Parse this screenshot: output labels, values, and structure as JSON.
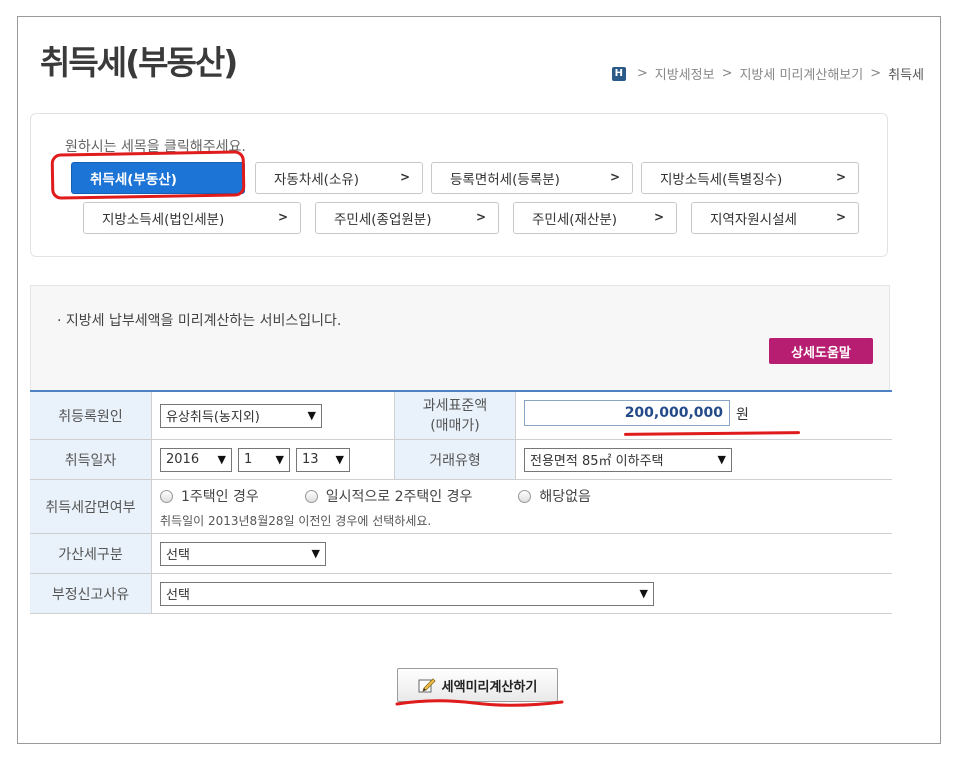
{
  "page": {
    "title": "취득세(부동산)"
  },
  "breadcrumb": {
    "home_icon": "H",
    "sep": ">",
    "items": [
      "지방세정보",
      "지방세 미리계산해보기",
      "취득세"
    ]
  },
  "tax_select": {
    "prompt": "원하시는 세목을 클릭해주세요.",
    "chevron": ">",
    "items": [
      {
        "label": "취득세(부동산)"
      },
      {
        "label": "자동차세(소유)"
      },
      {
        "label": "등록면허세(등록분)"
      },
      {
        "label": "지방소득세(특별징수)"
      },
      {
        "label": "지방소득세(법인세분)"
      },
      {
        "label": "주민세(종업원분)"
      },
      {
        "label": "주민세(재산분)"
      },
      {
        "label": "지역자원시설세"
      }
    ]
  },
  "info": {
    "text": "· 지방세 납부세액을 미리계산하는 서비스입니다.",
    "help_button": "상세도움말"
  },
  "form": {
    "acquisition_cause": {
      "label": "취등록원인",
      "value": "유상취득(농지외)"
    },
    "tax_base": {
      "label_line1": "과세표준액",
      "label_line2": "(매매가)",
      "value": "200,000,000",
      "unit": "원"
    },
    "acquisition_date": {
      "label": "취득일자",
      "year": "2016",
      "month": "1",
      "day": "13"
    },
    "transaction_type": {
      "label": "거래유형",
      "value": "전용면적 85㎡ 이하주택"
    },
    "reduction": {
      "label": "취득세감면여부",
      "options": [
        "1주택인 경우",
        "일시적으로 2주택인 경우",
        "해당없음"
      ],
      "note": "취득일이 2013년8월28일 이전인 경우에 선택하세요."
    },
    "surcharge": {
      "label": "가산세구분",
      "value": "선택"
    },
    "improper_report": {
      "label": "부정신고사유",
      "value": "선택"
    }
  },
  "calc_button": {
    "label": "세액미리계산하기"
  },
  "colors": {
    "active_tab": "#1c74d6",
    "help_button": "#b71d71",
    "annotation_red": "#e01b1b",
    "label_bg": "#e9f2fb"
  }
}
